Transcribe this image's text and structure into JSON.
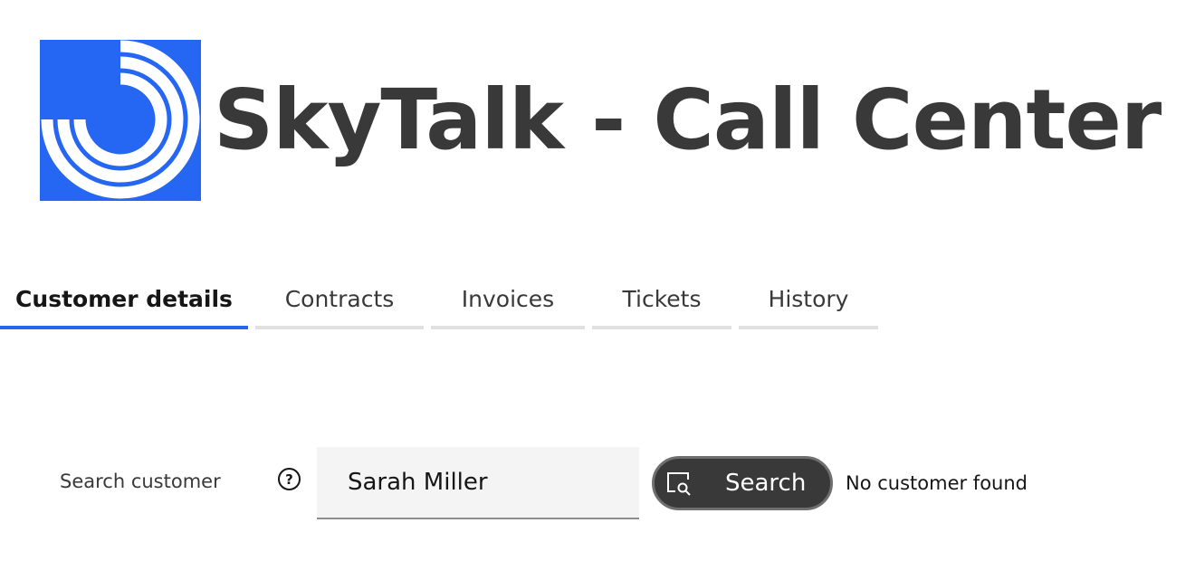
{
  "header": {
    "title": "SkyTalk - Call Center",
    "logo_color": "#2566f2",
    "logo_icon": "concentric-arcs-logo-icon"
  },
  "tabs": [
    {
      "label": "Customer details",
      "active": true
    },
    {
      "label": "Contracts",
      "active": false
    },
    {
      "label": "Invoices",
      "active": false
    },
    {
      "label": "Tickets",
      "active": false
    },
    {
      "label": "History",
      "active": false
    }
  ],
  "search": {
    "label": "Search customer",
    "help_icon": "question-circle-icon",
    "help_glyph": "?",
    "value": "Sarah Miller",
    "button_label": "Search",
    "button_icon": "search-icon",
    "status": "No customer found"
  },
  "colors": {
    "accent": "#2566f2",
    "button_bg": "#393939",
    "title_text": "#393939"
  }
}
